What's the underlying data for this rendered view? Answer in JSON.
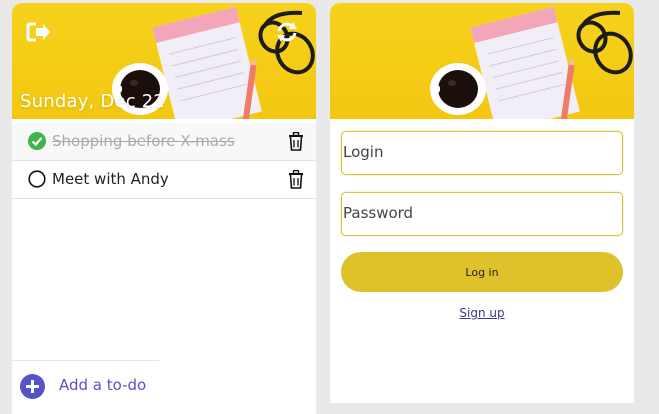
{
  "colors": {
    "hero_yellow": "#f6d21c",
    "accent_gold": "#dfc12c",
    "add_purple": "#5652c8",
    "done_green": "#3fb44b"
  },
  "todo_screen": {
    "date": "Sunday, Dec 22",
    "logout_icon": "logout-icon",
    "sync_icon": "sync-icon",
    "items": [
      {
        "text": "Shopping before X-mass",
        "done": true
      },
      {
        "text": "Meet with Andy",
        "done": false
      }
    ],
    "add_label": "Add a to-do"
  },
  "login_screen": {
    "login_placeholder": "Login",
    "password_placeholder": "Password",
    "login_button": "Log in",
    "signup_link": "Sign up"
  }
}
